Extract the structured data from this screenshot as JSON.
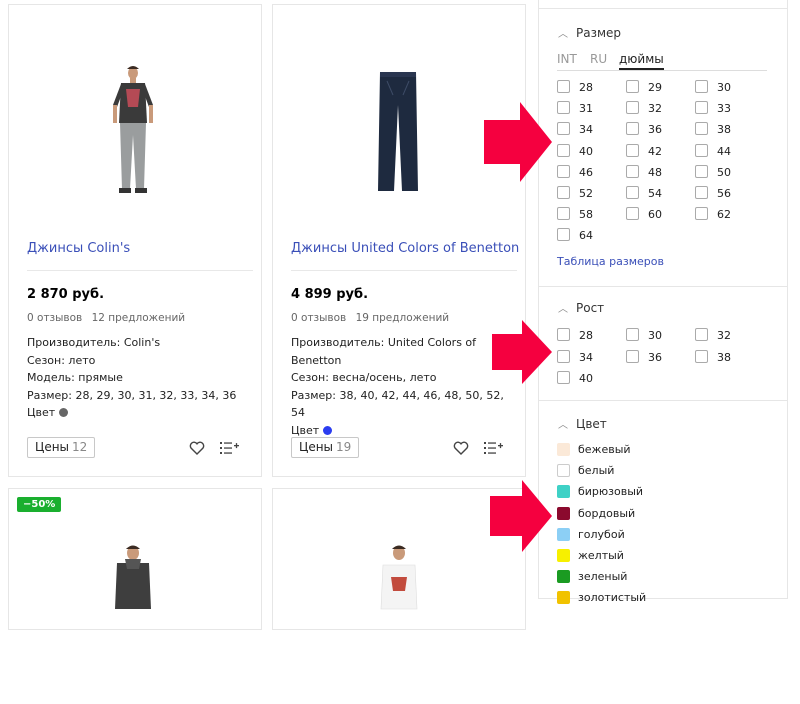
{
  "products": [
    {
      "title": "Джинсы Colin's",
      "price": "2 870 руб.",
      "reviews": "0 отзывов",
      "offers": "12 предложений",
      "specs": [
        "Производитель: Colin's",
        "Сезон: лето",
        "Модель: прямые",
        "Размер: 28, 29, 30, 31, 32, 33, 34, 36"
      ],
      "color_label": "Цвет",
      "color_hex": "#666666",
      "prices_label": "Цены",
      "prices_count": "12"
    },
    {
      "title": "Джинсы United Colors of Benetton",
      "price": "4 899 руб.",
      "reviews": "0 отзывов",
      "offers": "19 предложений",
      "specs": [
        "Производитель: United Colors of Benetton",
        "Сезон: весна/осень, лето",
        "Размер: 38, 40, 42, 44, 46, 48, 50, 52, 54"
      ],
      "color_label": "Цвет",
      "color_hex": "#2b3df0",
      "prices_label": "Цены",
      "prices_count": "19"
    },
    {
      "badge": "−50%"
    },
    {}
  ],
  "filters": {
    "size": {
      "title": "Размер",
      "tabs": [
        "INT",
        "RU",
        "дюймы"
      ],
      "active_tab": "дюймы",
      "options": [
        "28",
        "29",
        "30",
        "31",
        "32",
        "33",
        "34",
        "36",
        "38",
        "40",
        "42",
        "44",
        "46",
        "48",
        "50",
        "52",
        "54",
        "56",
        "58",
        "60",
        "62",
        "64"
      ],
      "table_link": "Таблица размеров"
    },
    "height": {
      "title": "Рост",
      "options": [
        "28",
        "30",
        "32",
        "34",
        "36",
        "38",
        "40"
      ]
    },
    "color": {
      "title": "Цвет",
      "options": [
        {
          "label": "бежевый",
          "hex": "#fbe9d8"
        },
        {
          "label": "белый",
          "hex": "#ffffff"
        },
        {
          "label": "бирюзовый",
          "hex": "#3fd1c6"
        },
        {
          "label": "бордовый",
          "hex": "#8b0a2e"
        },
        {
          "label": "голубой",
          "hex": "#8ccff5"
        },
        {
          "label": "желтый",
          "hex": "#f7f000"
        },
        {
          "label": "зеленый",
          "hex": "#1b9b22"
        },
        {
          "label": "золотистый",
          "hex": "#f1c200"
        }
      ]
    }
  },
  "colors": {
    "link": "#3a4fb8",
    "arrow": "#f5003f",
    "badge": "#1aaf2f"
  }
}
